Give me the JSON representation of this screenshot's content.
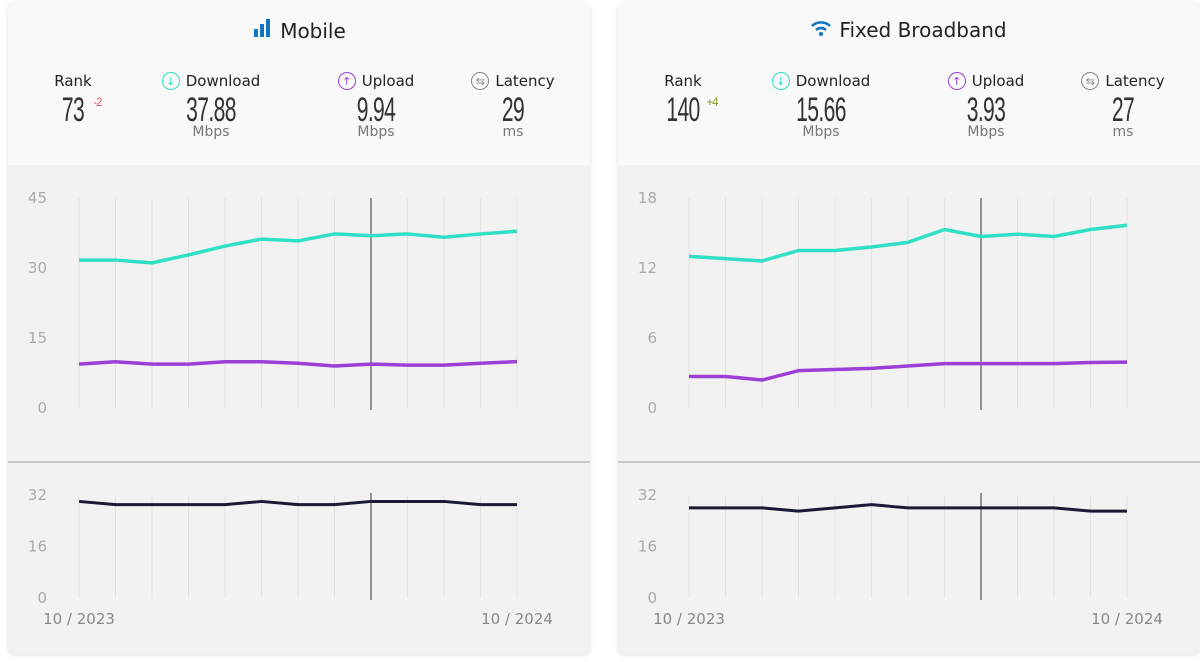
{
  "colors": {
    "download": "#2fe0c4",
    "upload": "#9b3fd6",
    "latency": "#1a1a33",
    "icon": "#1176bf",
    "up_delta": "#8a9a2a",
    "down_delta": "#e0506a"
  },
  "panels": [
    {
      "title": "Mobile",
      "icon": "signal-bars-icon",
      "rank": {
        "label": "Rank",
        "value": "73",
        "delta": "-2",
        "delta_dir": "down"
      },
      "download": {
        "label": "Download",
        "value": "37.88",
        "unit": "Mbps"
      },
      "upload": {
        "label": "Upload",
        "value": "9.94",
        "unit": "Mbps"
      },
      "latency": {
        "label": "Latency",
        "value": "29",
        "unit": "ms"
      },
      "chart_data": {
        "type": "line",
        "x_labels": [
          "10 / 2023",
          "10 / 2024"
        ],
        "x_count": 13,
        "cursor_index": 8,
        "speed": {
          "ylim": [
            0,
            45
          ],
          "ticks": [
            "45",
            "30",
            "15",
            "0"
          ],
          "series": [
            {
              "key": "download",
              "values": [
                31.7,
                31.7,
                31.1,
                32.8,
                34.7,
                36.2,
                35.8,
                37.3,
                36.9,
                37.3,
                36.6,
                37.3,
                37.88
              ]
            },
            {
              "key": "upload",
              "values": [
                9.4,
                9.9,
                9.4,
                9.4,
                9.9,
                9.9,
                9.6,
                9.0,
                9.4,
                9.2,
                9.2,
                9.6,
                9.94
              ]
            }
          ]
        },
        "latency": {
          "ylim": [
            0,
            32
          ],
          "ticks": [
            "32",
            "16",
            "0"
          ],
          "values": [
            30,
            29,
            29,
            29,
            29,
            30,
            29,
            29,
            30,
            30,
            30,
            29,
            29
          ]
        }
      }
    },
    {
      "title": "Fixed Broadband",
      "icon": "wifi-icon",
      "rank": {
        "label": "Rank",
        "value": "140",
        "delta": "+4",
        "delta_dir": "up"
      },
      "download": {
        "label": "Download",
        "value": "15.66",
        "unit": "Mbps"
      },
      "upload": {
        "label": "Upload",
        "value": "3.93",
        "unit": "Mbps"
      },
      "latency": {
        "label": "Latency",
        "value": "27",
        "unit": "ms"
      },
      "chart_data": {
        "type": "line",
        "x_labels": [
          "10 / 2023",
          "10 / 2024"
        ],
        "x_count": 13,
        "cursor_index": 8,
        "speed": {
          "ylim": [
            0,
            18
          ],
          "ticks": [
            "18",
            "12",
            "6",
            "0"
          ],
          "series": [
            {
              "key": "download",
              "values": [
                13.0,
                12.8,
                12.6,
                13.5,
                13.5,
                13.8,
                14.2,
                15.3,
                14.7,
                14.9,
                14.7,
                15.3,
                15.66
              ]
            },
            {
              "key": "upload",
              "values": [
                2.7,
                2.7,
                2.4,
                3.2,
                3.3,
                3.4,
                3.6,
                3.8,
                3.8,
                3.8,
                3.8,
                3.9,
                3.93
              ]
            }
          ]
        },
        "latency": {
          "ylim": [
            0,
            32
          ],
          "ticks": [
            "32",
            "16",
            "0"
          ],
          "values": [
            28,
            28,
            28,
            27,
            28,
            29,
            28,
            28,
            28,
            28,
            28,
            27,
            27
          ]
        }
      }
    }
  ]
}
